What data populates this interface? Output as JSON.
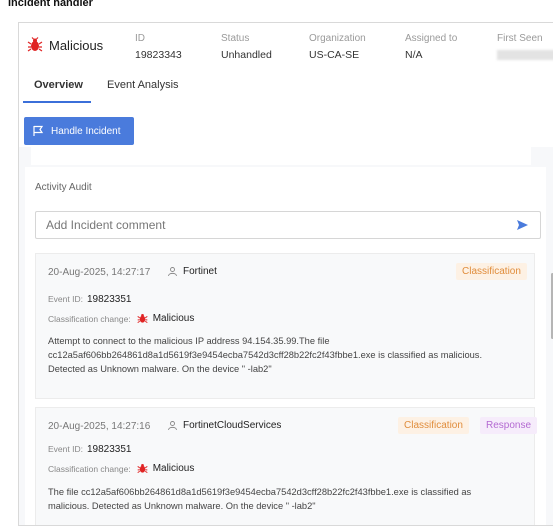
{
  "page_caption": "Incident handler",
  "header": {
    "title": "Malicious",
    "columns": [
      {
        "label": "ID",
        "value": "19823343"
      },
      {
        "label": "Status",
        "value": "Unhandled"
      },
      {
        "label": "Organization",
        "value": "US-CA-SE"
      },
      {
        "label": "Assigned to",
        "value": "N/A"
      },
      {
        "label": "First Seen",
        "value": ""
      }
    ]
  },
  "tabs": [
    {
      "label": "Overview",
      "active": true
    },
    {
      "label": "Event Analysis",
      "active": false
    }
  ],
  "handle_button": "Handle Incident",
  "activity": {
    "title": "Activity Audit",
    "comment_placeholder": "Add Incident comment",
    "entries": [
      {
        "timestamp": "20-Aug-2025, 14:27:17",
        "user": "Fortinet",
        "badges": [
          "Classification"
        ],
        "event_id_label": "Event ID:",
        "event_id": "19823351",
        "classification_label": "Classification change:",
        "classification_value": "Malicious",
        "description": [
          "Attempt to connect to the malicious IP address 94.154.35.99.The file",
          "cc12a5af606bb264861d8a1d5619f3e9454ecba7542d3cff28b22fc2f43fbbe1.exe is classified as malicious.",
          "Detected as Unknown malware. On the device \"          -lab2\""
        ]
      },
      {
        "timestamp": "20-Aug-2025, 14:27:16",
        "user": "FortinetCloudServices",
        "badges": [
          "Classification",
          "Response"
        ],
        "event_id_label": "Event ID:",
        "event_id": "19823351",
        "classification_label": "Classification change:",
        "classification_value": "Malicious",
        "description": [
          "The file cc12a5af606bb264861d8a1d5619f3e9454ecba7542d3cff28b22fc2f43fbbe1.exe is classified as",
          "malicious. Detected as Unknown malware. On the device \"          -lab2\""
        ]
      }
    ]
  },
  "colors": {
    "accent": "#4a7bdc",
    "malicious": "#e02424",
    "classification_badge": "#e08d3c",
    "response_badge": "#b46ad2"
  },
  "icons": {
    "malicious": "bug-icon",
    "flag": "flag-icon",
    "user": "user-icon",
    "send": "send-icon"
  }
}
